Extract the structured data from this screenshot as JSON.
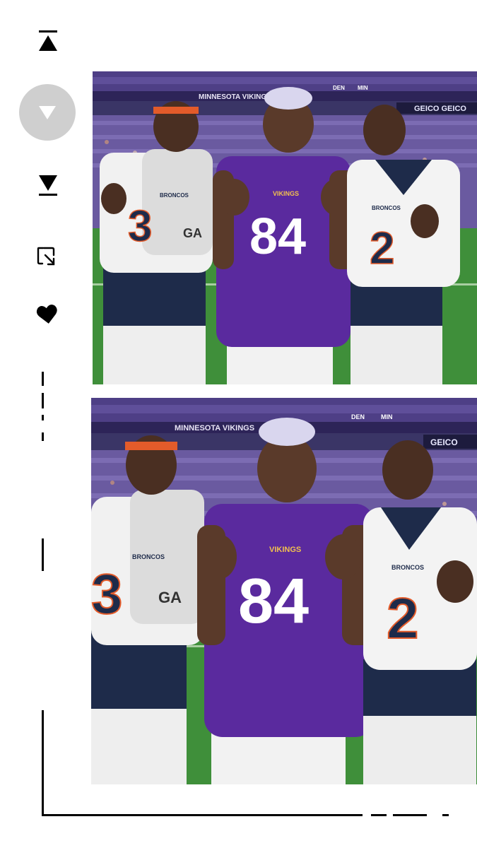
{
  "toolbar": {
    "buttons": [
      {
        "name": "scroll-to-top",
        "icon": "scroll-top-icon"
      },
      {
        "name": "scroll-down",
        "icon": "chevron-down-icon",
        "active": true
      },
      {
        "name": "scroll-to-bottom",
        "icon": "scroll-bottom-icon"
      },
      {
        "name": "crop",
        "icon": "crop-icon"
      },
      {
        "name": "favorite",
        "icon": "heart-icon"
      }
    ]
  },
  "photos": [
    {
      "stadium_banner": "MINNESOTA VIKINGS",
      "sign_right": "GEICO GEICO",
      "sign_right_2": "DEN",
      "sign_right_3": "MIN",
      "players": [
        {
          "team": "BRONCOS",
          "number": "3",
          "towel_text": "GA"
        },
        {
          "team": "VIKINGS",
          "number": "84"
        },
        {
          "team": "BRONCOS",
          "number": "2"
        }
      ]
    },
    {
      "stadium_banner": "MINNESOTA VIKINGS",
      "sign_right": "GEICO",
      "sign_right_2": "DEN",
      "sign_right_3": "MIN",
      "players": [
        {
          "team": "BRONCOS",
          "number": "3",
          "towel_text": "GA"
        },
        {
          "team": "VIKINGS",
          "number": "84"
        },
        {
          "team": "BRONCOS",
          "number": "2"
        }
      ]
    }
  ],
  "colors": {
    "vikings_purple": "#5a2a9e",
    "broncos_navy": "#1e2b4a",
    "broncos_orange": "#e35b2a",
    "field_green": "#3f8f3a",
    "stadium_seats": "#5a4a8a"
  }
}
